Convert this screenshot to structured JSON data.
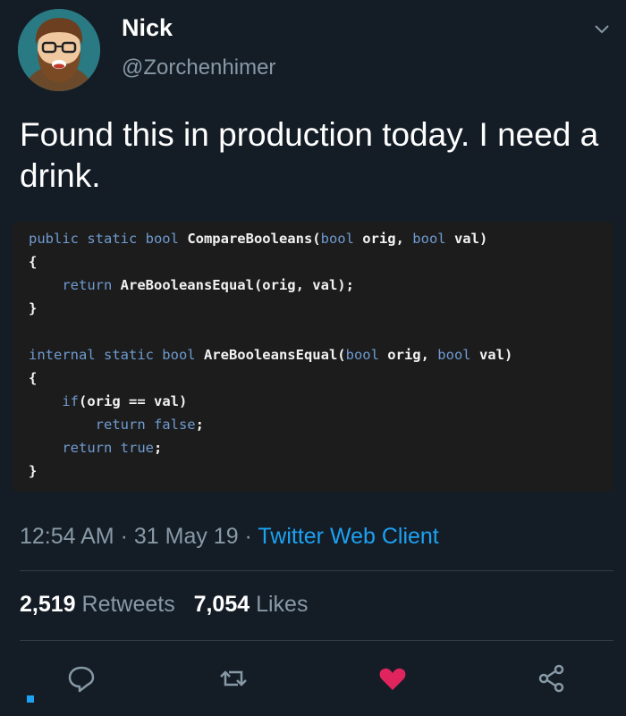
{
  "author": {
    "name": "Nick",
    "handle": "@Zorchenhimer",
    "avatar_icon": "cartoon-bearded-man-avatar"
  },
  "tweet": {
    "text": "Found this in production today.  I need a drink."
  },
  "code": {
    "lines": [
      [
        {
          "t": "public static bool ",
          "c": "kw"
        },
        {
          "t": "CompareBooleans(",
          "c": "id"
        },
        {
          "t": "bool ",
          "c": "kw"
        },
        {
          "t": "orig, ",
          "c": "id"
        },
        {
          "t": "bool ",
          "c": "kw"
        },
        {
          "t": "val)",
          "c": "id"
        }
      ],
      [
        {
          "t": "{",
          "c": "id"
        }
      ],
      [
        {
          "t": "    ",
          "c": "id"
        },
        {
          "t": "return ",
          "c": "kw"
        },
        {
          "t": "AreBooleansEqual(orig, val);",
          "c": "id"
        }
      ],
      [
        {
          "t": "}",
          "c": "id"
        }
      ],
      [],
      [
        {
          "t": "internal static bool ",
          "c": "kw"
        },
        {
          "t": "AreBooleansEqual(",
          "c": "id"
        },
        {
          "t": "bool ",
          "c": "kw"
        },
        {
          "t": "orig, ",
          "c": "id"
        },
        {
          "t": "bool ",
          "c": "kw"
        },
        {
          "t": "val)",
          "c": "id"
        }
      ],
      [
        {
          "t": "{",
          "c": "id"
        }
      ],
      [
        {
          "t": "    ",
          "c": "id"
        },
        {
          "t": "if",
          "c": "kw"
        },
        {
          "t": "(orig == val)",
          "c": "id"
        }
      ],
      [
        {
          "t": "        ",
          "c": "id"
        },
        {
          "t": "return false",
          "c": "kw"
        },
        {
          "t": ";",
          "c": "id"
        }
      ],
      [
        {
          "t": "    ",
          "c": "id"
        },
        {
          "t": "return true",
          "c": "kw"
        },
        {
          "t": ";",
          "c": "id"
        }
      ],
      [
        {
          "t": "}",
          "c": "id"
        }
      ]
    ]
  },
  "meta": {
    "time": "12:54 AM",
    "date": "31 May 19",
    "separator": " · ",
    "client": "Twitter Web Client"
  },
  "stats": {
    "retweets_count": "2,519",
    "retweets_label": "Retweets",
    "likes_count": "7,054",
    "likes_label": "Likes"
  },
  "actions": {
    "reply_icon": "reply-icon",
    "retweet_icon": "retweet-icon",
    "like_icon": "heart-icon",
    "share_icon": "share-icon",
    "like_color": "#e0245e",
    "icon_color": "#8899a6"
  },
  "colors": {
    "background": "#141d26",
    "accent": "#1da1f2",
    "secondary_text": "#8899a6",
    "code_background": "#1c1c1c",
    "code_keyword": "#6f9bd1"
  }
}
